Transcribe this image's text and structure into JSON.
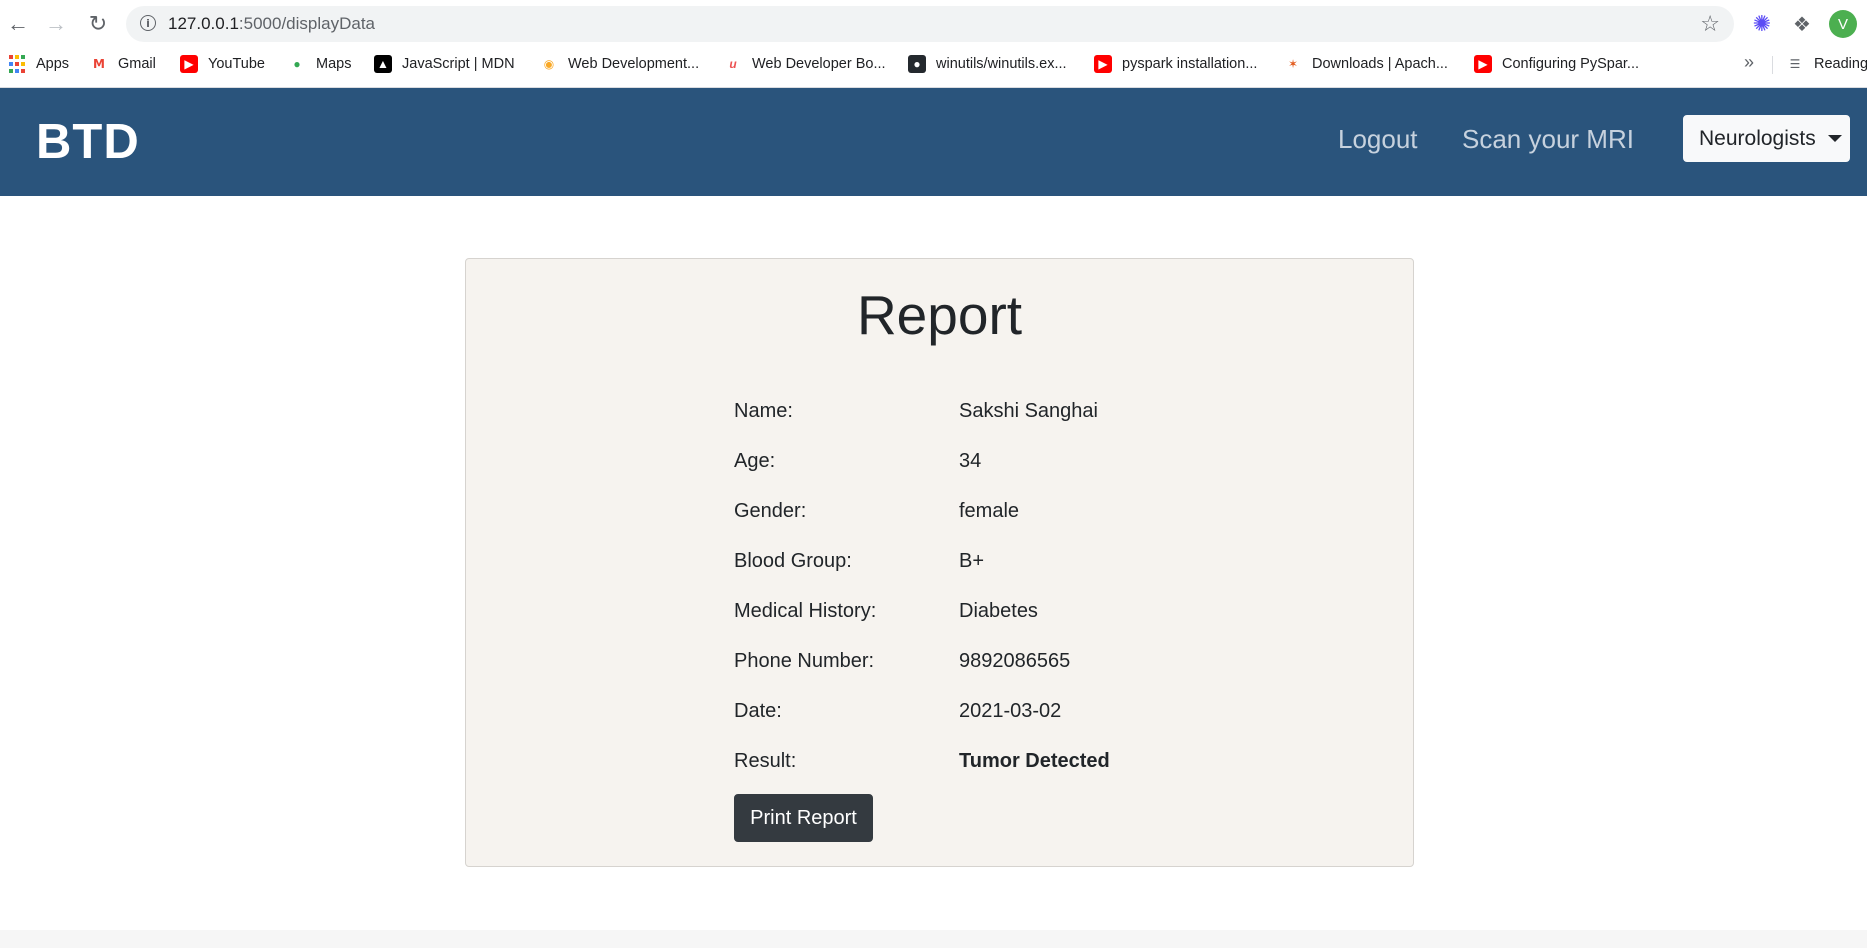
{
  "browser": {
    "url_host": "127.0.0.1",
    "url_path": ":5000/displayData",
    "avatar_letter": "V",
    "bookmarks": [
      {
        "label": "Apps",
        "icon": "apps-grid-icon"
      },
      {
        "label": "Gmail",
        "icon": "gmail-icon"
      },
      {
        "label": "YouTube",
        "icon": "youtube-icon"
      },
      {
        "label": "Maps",
        "icon": "maps-icon"
      },
      {
        "label": "JavaScript | MDN",
        "icon": "mdn-icon"
      },
      {
        "label": "Web Development...",
        "icon": "web-dev-icon"
      },
      {
        "label": "Web Developer Bo...",
        "icon": "udemy-icon"
      },
      {
        "label": "winutils/winutils.ex...",
        "icon": "github-icon"
      },
      {
        "label": "pyspark installation...",
        "icon": "youtube-icon"
      },
      {
        "label": "Downloads | Apach...",
        "icon": "spark-icon"
      },
      {
        "label": "Configuring PySpar...",
        "icon": "youtube-icon"
      }
    ],
    "more_label": "»",
    "reading_label": "Reading"
  },
  "navbar": {
    "brand": "BTD",
    "links": [
      "Logout",
      "Scan your MRI"
    ],
    "dropdown_label": "Neurologists"
  },
  "report": {
    "title": "Report",
    "rows": [
      {
        "label": "Name:",
        "value": "Sakshi Sanghai"
      },
      {
        "label": "Age:",
        "value": "34"
      },
      {
        "label": "Gender:",
        "value": "female"
      },
      {
        "label": "Blood Group:",
        "value": "B+"
      },
      {
        "label": "Medical History:",
        "value": "Diabetes"
      },
      {
        "label": "Phone Number:",
        "value": "9892086565"
      },
      {
        "label": "Date:",
        "value": "2021-03-02"
      },
      {
        "label": "Result:",
        "value": "Tumor Detected"
      }
    ],
    "print_label": "Print Report"
  },
  "colors": {
    "navbar_bg": "#2a547c",
    "card_bg": "#f6f3ef",
    "button_dark": "#343a40"
  }
}
